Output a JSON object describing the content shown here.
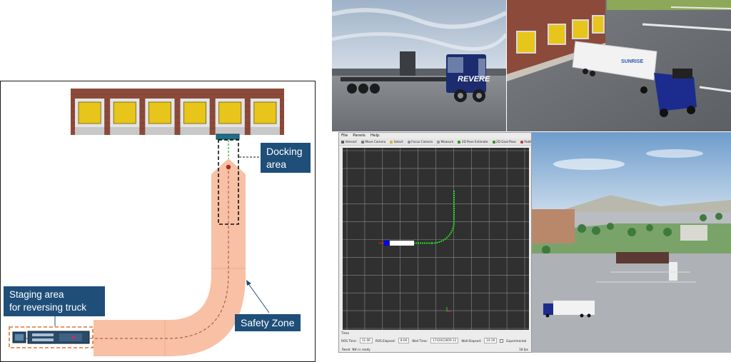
{
  "diagram": {
    "docking_label": "Docking\narea",
    "staging_label": "Staging area\nfor reversing truck",
    "safety_label": "Safety Zone",
    "dock_door_count": 6
  },
  "rviz": {
    "menu": [
      "File",
      "Panels",
      "Help"
    ],
    "toolbar": [
      "Interact",
      "Move Camera",
      "Select",
      "Focus Camera",
      "Measure",
      "2D Pose Estimate",
      "2D Goal Pose",
      "Publish Point"
    ],
    "time_header": "Time",
    "time": {
      "ros_time_label": "ROS Time:",
      "ros_time": "11.06",
      "ros_elapsed_label": "ROS Elapsed:",
      "ros_elapsed": "8.06",
      "wall_time_label": "Wall Time:",
      "wall_time": "1741012859.12",
      "wall_elapsed_label": "Wall Elapsed:",
      "wall_elapsed": "24.26",
      "experimental_label": "Experimental"
    },
    "status": {
      "reset": "Reset",
      "message": "Nth is ready",
      "fps": "18 fps"
    },
    "colors": {
      "grid_bg": "#303030",
      "grid_line": "#8a8a8a",
      "path": "#22dd22",
      "trailer": "#ffffff",
      "tractor": "#0000ff"
    }
  },
  "photos": {
    "side_trailer_brand": "REVERE",
    "top_trailer_brand": "SUNRISE"
  },
  "colors": {
    "callout_bg": "#1f4e79",
    "safety_zone": "#f8c0a4",
    "staging_box": "#e8702a",
    "door_yellow": "#e7c51a",
    "brick": "#8b4a3a"
  }
}
